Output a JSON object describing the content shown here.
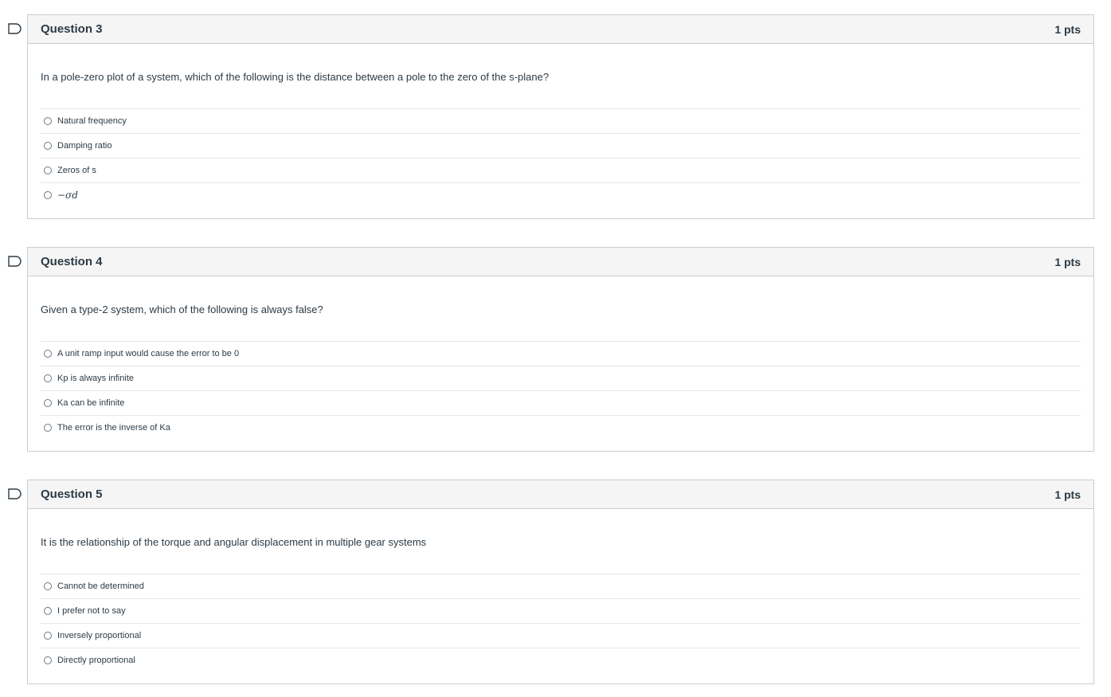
{
  "questions": [
    {
      "title": "Question 3",
      "points": "1 pts",
      "text": "In a pole-zero plot of a system, which of the following is the distance between a pole to the zero of the s-plane?",
      "answers": [
        {
          "label": "Natural frequency"
        },
        {
          "label": "Damping ratio"
        },
        {
          "label": "Zeros of s"
        },
        {
          "label": "−σd"
        }
      ]
    },
    {
      "title": "Question 4",
      "points": "1 pts",
      "text": "Given a type-2 system, which of the following is always false?",
      "answers": [
        {
          "label": "A unit ramp input would cause the error to be 0"
        },
        {
          "label": "Kp is always infinite"
        },
        {
          "label": "Ka can be infinite"
        },
        {
          "label": "The error is the inverse of Ka"
        }
      ]
    },
    {
      "title": "Question 5",
      "points": "1 pts",
      "text": "It is the relationship of the torque and angular displacement in multiple gear systems",
      "answers": [
        {
          "label": "Cannot be determined"
        },
        {
          "label": "I prefer not to say"
        },
        {
          "label": "Inversely proportional"
        },
        {
          "label": "Directly proportional"
        }
      ]
    }
  ],
  "icons": {
    "flag": "flag-question-icon",
    "radio": "radio-button-icon"
  },
  "colors": {
    "header_bg": "#f5f5f5",
    "border": "#c7cdd1",
    "text": "#2d3b45",
    "divider": "#e5e5e5"
  }
}
